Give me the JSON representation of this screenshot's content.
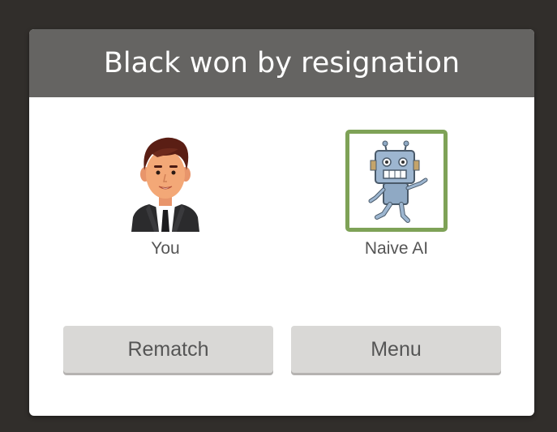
{
  "dialog": {
    "title": "Black won by resignation"
  },
  "players": [
    {
      "name": "You",
      "icon": "person-avatar-icon"
    },
    {
      "name": "Naive AI",
      "icon": "robot-avatar-icon",
      "selected": true
    }
  ],
  "buttons": {
    "rematch_label": "Rematch",
    "menu_label": "Menu"
  },
  "colors": {
    "background": "#312e2b",
    "header": "#656462",
    "selected_border": "#7ea257",
    "button": "#d9d8d6"
  }
}
